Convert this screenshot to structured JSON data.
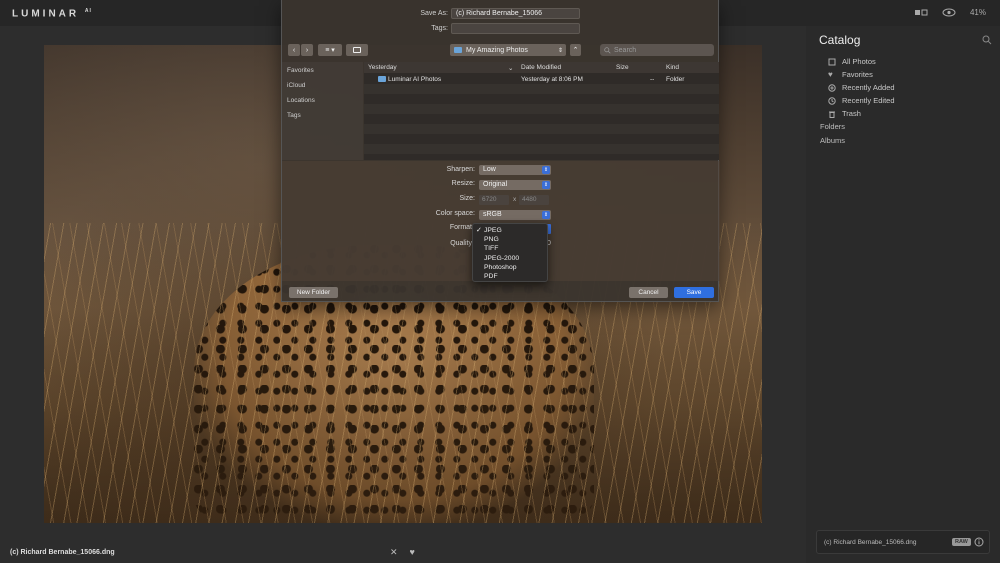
{
  "app": {
    "logo": "LUMINAR",
    "logo_sup": "AI",
    "zoom": "41%"
  },
  "photo": {
    "filename": "(c) Richard Bernabe_15066.dng"
  },
  "panel": {
    "title": "Catalog",
    "items": [
      {
        "label": "All Photos",
        "icon": "photos-icon"
      },
      {
        "label": "Favorites",
        "icon": "heart-icon"
      },
      {
        "label": "Recently Added",
        "icon": "plus-circle-icon"
      },
      {
        "label": "Recently Edited",
        "icon": "clock-icon"
      },
      {
        "label": "Trash",
        "icon": "trash-icon"
      }
    ],
    "folders": "Folders",
    "albums": "Albums",
    "file_card_name": "(c) Richard Bernabe_15066.dng",
    "raw_badge": "RAW"
  },
  "dialog": {
    "save_as_label": "Save As:",
    "save_as_value": "(c) Richard Bernabe_15066",
    "tags_label": "Tags:",
    "tags_value": "",
    "location": "My Amazing Photos",
    "search_placeholder": "Search",
    "sidebar": [
      "Favorites",
      "iCloud",
      "Locations",
      "Tags"
    ],
    "columns": {
      "name": "Yesterday",
      "date": "Date Modified",
      "size": "Size",
      "kind": "Kind"
    },
    "rows": [
      {
        "name": "Luminar AI Photos",
        "date": "Yesterday at 8:06 PM",
        "size": "--",
        "kind": "Folder"
      }
    ],
    "options": {
      "sharpen_label": "Sharpen:",
      "sharpen_value": "Low",
      "resize_label": "Resize:",
      "resize_value": "Original",
      "size_label": "Size:",
      "size_w": "6720",
      "size_x": "x",
      "size_h": "4480",
      "colorspace_label": "Color space:",
      "colorspace_value": "sRGB",
      "format_label": "Format",
      "quality_label": "Quality",
      "quality_value": "0"
    },
    "format_menu": {
      "checked": "✓",
      "items": [
        "JPEG",
        "PNG",
        "TIFF",
        "JPEG-2000",
        "Photoshop",
        "PDF"
      ]
    },
    "new_folder": "New Folder",
    "cancel": "Cancel",
    "save": "Save"
  }
}
